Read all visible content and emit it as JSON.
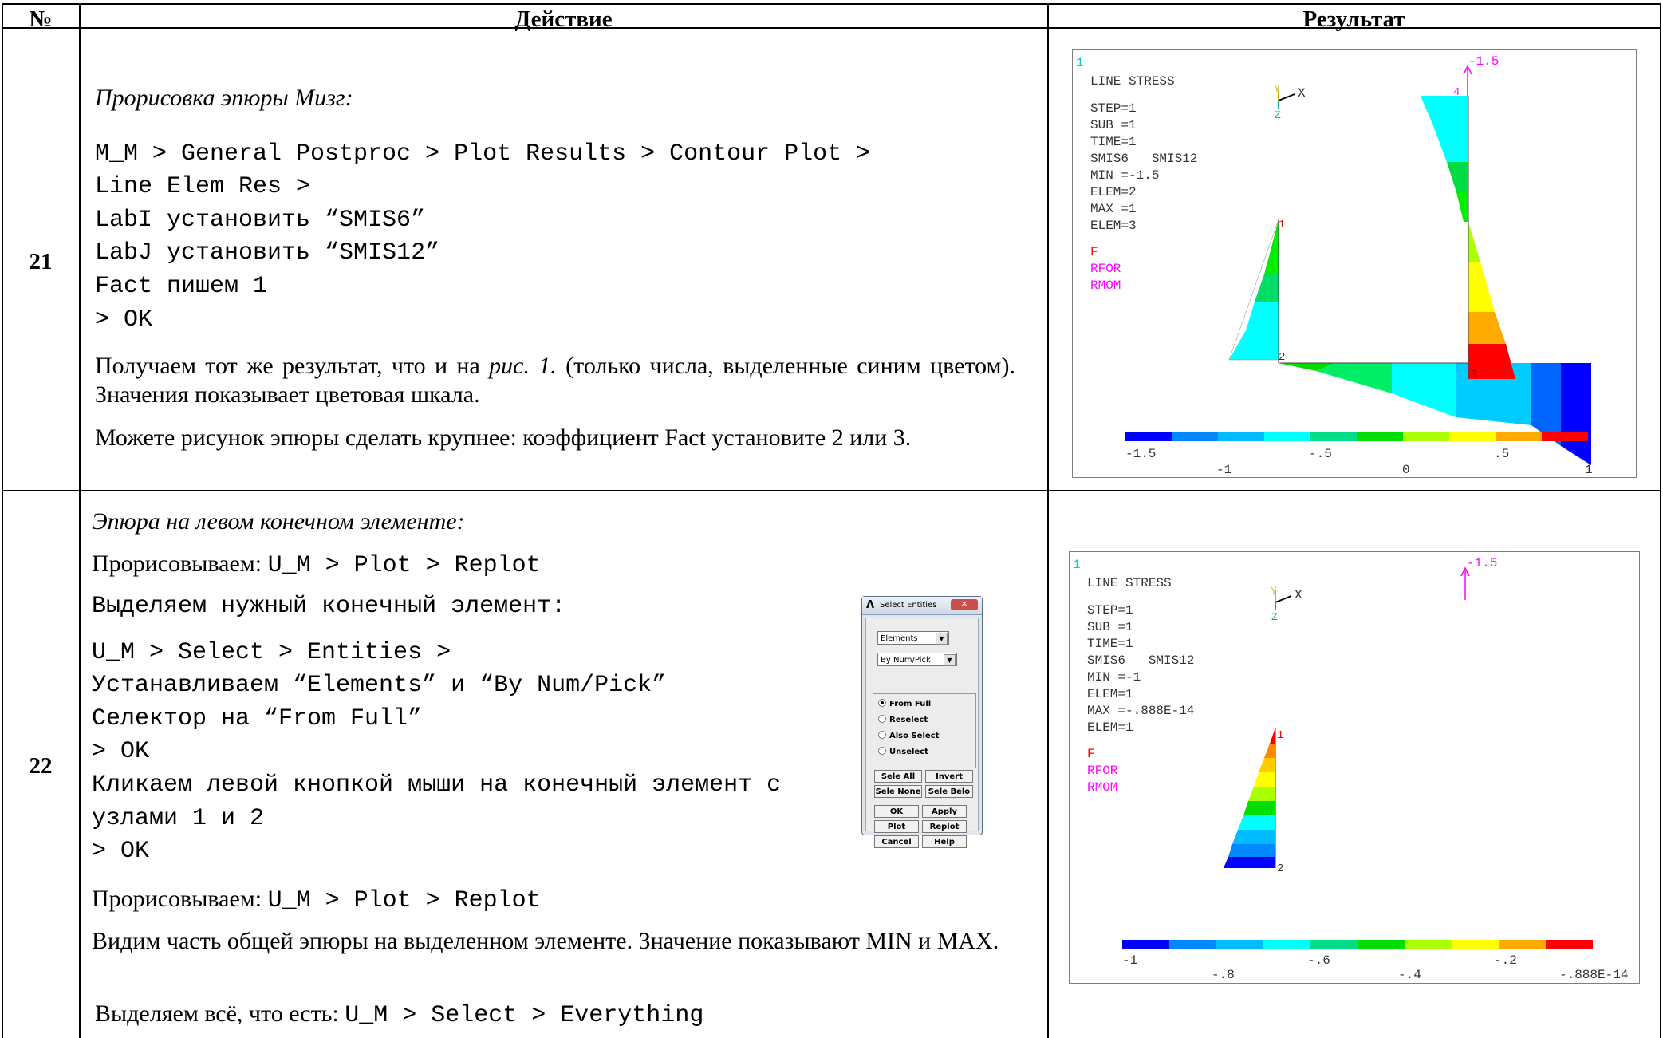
{
  "table": {
    "headers": {
      "num": "№",
      "action": "Действие",
      "result": "Результат"
    }
  },
  "row21": {
    "num": "21",
    "title": "Прорисовка эпюры Мизг:",
    "code": [
      "M_M > General Postproc > Plot Results > Contour Plot >",
      "Line Elem Res >",
      "LabI установить “SMIS6”",
      "LabJ установить “SMIS12”",
      "Fact пишем 1",
      "> OK"
    ],
    "para1_a": "Получаем тот же результат, что и на ",
    "para1_ref": "рис. 1.",
    "para1_b": " (только числа, выделенные синим цветом). Значения показывает цветовая шкала.",
    "para2": "Можете рисунок эпюры сделать крупнее: коэффициент Fact установите 2 или 3.",
    "plot": {
      "corner": "1",
      "label": "LINE STRESS",
      "info": [
        "STEP=1",
        "SUB =1",
        "TIME=1",
        "SMIS6   SMIS12",
        "MIN =-1.5",
        "ELEM=2",
        "MAX =1",
        "ELEM=3"
      ],
      "loads": [
        "F",
        "RFOR",
        "RMOM"
      ],
      "axes": {
        "y": "Y",
        "x": "X",
        "z": "Z"
      },
      "node_labels": {
        "n1": "1",
        "n2": "2",
        "n3": "3",
        "n4": "4"
      },
      "moment_label": "-1.5",
      "scale_top": [
        "-1.5",
        "-.5",
        ".5"
      ],
      "scale_bottom": [
        "-1",
        "0",
        "1"
      ]
    }
  },
  "row22": {
    "num": "22",
    "title": "Эпюра на левом конечном элементе:",
    "line1_a": "Прорисовываем: ",
    "line1_b": "U_M > Plot > Replot",
    "line2": "Выделяем нужный конечный элемент:",
    "code": [
      "U_M > Select > Entities >",
      "Устанавливаем “Elements” и “By Num/Pick”",
      "Селектор на “From Full”",
      "> OK",
      "Кликаем левой кнопкой мыши на конечный элемент с",
      "узлами 1 и 2",
      "> OK"
    ],
    "line3_a": "Прорисовываем: ",
    "line3_b": "U_M > Plot > Replot",
    "para1": "Видим часть общей эпюры на выделенном элементе. Значение показывают MIN и MAX.",
    "line4_a": "Выделяем всё, что есть: ",
    "line4_b": "U_M > Select > Everything",
    "dialog": {
      "title": "Select Entities",
      "type_value": "Elements",
      "method_value": "By Num/Pick",
      "radios": [
        "From Full",
        "Reselect",
        "Also Select",
        "Unselect"
      ],
      "buttons": [
        "Sele All",
        "Invert",
        "Sele None",
        "Sele Belo",
        "OK",
        "Apply",
        "Plot",
        "Replot",
        "Cancel",
        "Help"
      ]
    },
    "plot": {
      "corner": "1",
      "label": "LINE STRESS",
      "info": [
        "STEP=1",
        "SUB =1",
        "TIME=1",
        "SMIS6   SMIS12",
        "MIN =-1",
        "ELEM=1",
        "MAX =-.888E-14",
        "ELEM=1"
      ],
      "loads": [
        "F",
        "RFOR",
        "RMOM"
      ],
      "axes": {
        "y": "Y",
        "x": "X",
        "z": "Z"
      },
      "node_labels": {
        "n1": "1",
        "n2": "2"
      },
      "moment_label": "-1.5",
      "scale_top": [
        "-1",
        "-.6",
        "-.2"
      ],
      "scale_bottom": [
        "-.8",
        "-.4",
        "-.888E-14"
      ]
    }
  },
  "colors": {
    "contour": [
      "#0000ff",
      "#0077ff",
      "#00bbff",
      "#00ffff",
      "#00e0a0",
      "#00dd00",
      "#88ee00",
      "#ffff00",
      "#ffbb00",
      "#ff8800",
      "#ff0000"
    ],
    "load_f": "#ff0000",
    "load_r": "#ff00ff",
    "axis": "#00aaaa"
  }
}
